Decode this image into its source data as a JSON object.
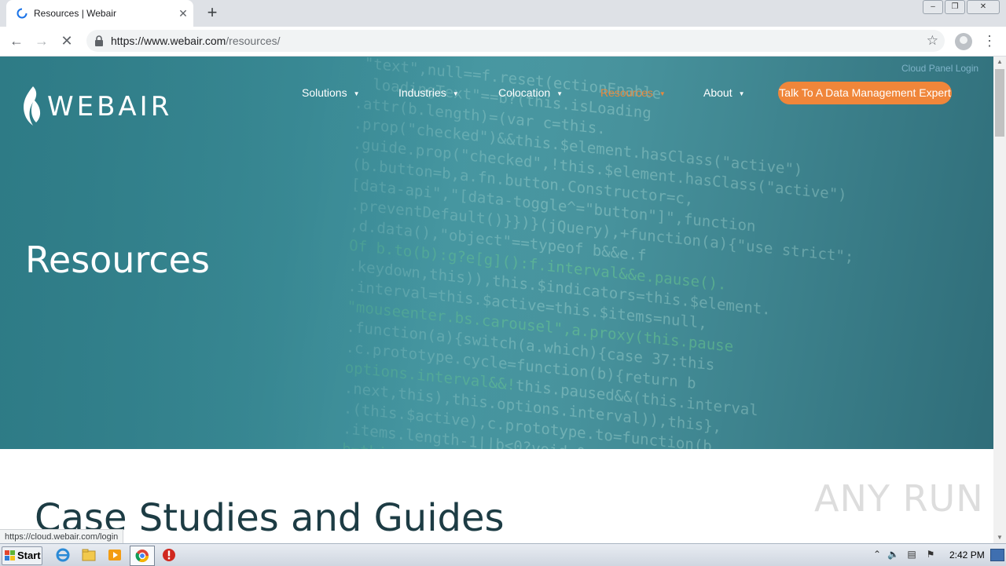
{
  "browser": {
    "tab_title": "Resources | Webair",
    "url_host": "https://www.webair.com",
    "url_path": "/resources/",
    "status_url": "https://cloud.webair.com/login"
  },
  "site": {
    "logo_text": "WEBAIR",
    "cloud_login": "Cloud Panel Login",
    "nav": [
      {
        "label": "Solutions"
      },
      {
        "label": "Industries"
      },
      {
        "label": "Colocation"
      },
      {
        "label": "Resources"
      },
      {
        "label": "About"
      }
    ],
    "cta": "Talk To A Data Management Expert",
    "hero_title": "Resources",
    "section_title": "Case Studies and Guides",
    "watermark": "ANY RUN"
  },
  "taskbar": {
    "start_label": "Start",
    "clock": "2:42 PM"
  },
  "colors": {
    "accent_orange": "#f0863a",
    "hero_teal": "#3a8a95",
    "heading_dark": "#1d3c44"
  }
}
